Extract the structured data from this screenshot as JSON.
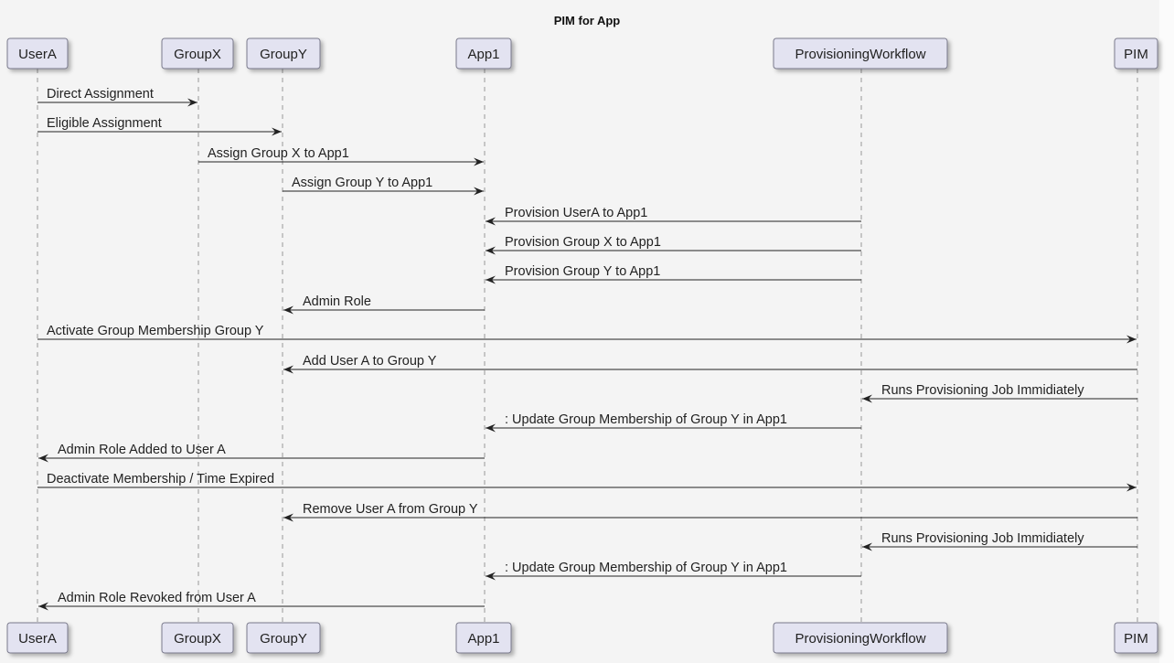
{
  "title": "PIM for App",
  "colors": {
    "background": "#f4f4f4",
    "participant_fill": "#e3e3f1",
    "participant_border": "#7a7a8c",
    "lifeline": "#a8a8a8",
    "arrow": "#222222"
  },
  "participants": [
    {
      "id": "UserA",
      "label": "UserA"
    },
    {
      "id": "GroupX",
      "label": "GroupX"
    },
    {
      "id": "GroupY",
      "label": "GroupY"
    },
    {
      "id": "App1",
      "label": "App1"
    },
    {
      "id": "ProvisioningWorkflow",
      "label": "ProvisioningWorkflow"
    },
    {
      "id": "PIM",
      "label": "PIM"
    }
  ],
  "messages": [
    {
      "from": "UserA",
      "to": "GroupX",
      "label": "Direct Assignment"
    },
    {
      "from": "UserA",
      "to": "GroupY",
      "label": "Eligible Assignment"
    },
    {
      "from": "GroupX",
      "to": "App1",
      "label": "Assign Group X to App1"
    },
    {
      "from": "GroupY",
      "to": "App1",
      "label": "Assign Group Y to App1"
    },
    {
      "from": "ProvisioningWorkflow",
      "to": "App1",
      "label": "Provision UserA to App1"
    },
    {
      "from": "ProvisioningWorkflow",
      "to": "App1",
      "label": "Provision Group X to App1"
    },
    {
      "from": "ProvisioningWorkflow",
      "to": "App1",
      "label": "Provision Group Y to App1"
    },
    {
      "from": "App1",
      "to": "GroupY",
      "label": "Admin Role"
    },
    {
      "from": "UserA",
      "to": "PIM",
      "label": "Activate Group Membership Group Y"
    },
    {
      "from": "PIM",
      "to": "GroupY",
      "label": "Add User A to Group Y"
    },
    {
      "from": "PIM",
      "to": "ProvisioningWorkflow",
      "label": "Runs Provisioning Job Immidiately"
    },
    {
      "from": "ProvisioningWorkflow",
      "to": "App1",
      "label": ": Update Group Membership of Group Y in App1"
    },
    {
      "from": "App1",
      "to": "UserA",
      "label": "Admin Role Added to User A"
    },
    {
      "from": "UserA",
      "to": "PIM",
      "label": "Deactivate Membership / Time Expired"
    },
    {
      "from": "PIM",
      "to": "GroupY",
      "label": "Remove User A from Group Y"
    },
    {
      "from": "PIM",
      "to": "ProvisioningWorkflow",
      "label": "Runs Provisioning Job Immidiately"
    },
    {
      "from": "ProvisioningWorkflow",
      "to": "App1",
      "label": ": Update Group Membership of Group Y in App1"
    },
    {
      "from": "App1",
      "to": "UserA",
      "label": "Admin Role Revoked from User A"
    }
  ]
}
